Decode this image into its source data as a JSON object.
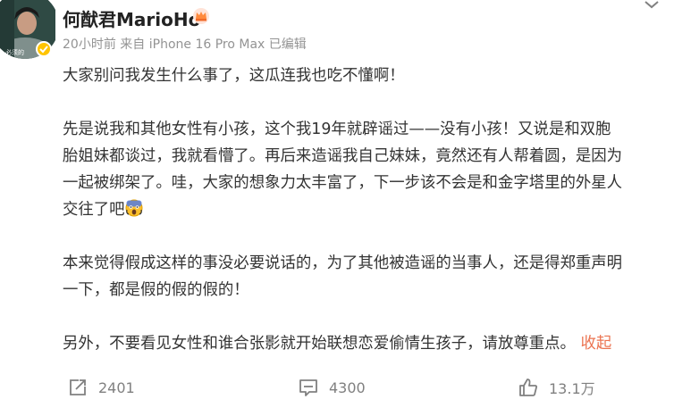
{
  "post": {
    "author": "何猷君MarioHo",
    "time": "20小时前",
    "source_prefix": "来自",
    "device": "iPhone 16 Pro Max",
    "edited": "已编辑",
    "avatar_caption": "必须的"
  },
  "content": {
    "p1": "大家别问我发生什么事了，这瓜连我也吃不懂啊！",
    "p2_l1": "先是说我和其他女性有小孩，这个我19年就辟谣过——没有小孩！又说是和双胞",
    "p2_l2": "胎姐妹都谈过，我就看懵了。再后来造谣我自己妹妹，竟然还有人帮着圆，是因为",
    "p2_l3": "一起被绑架了。哇，大家的想象力太丰富了，下一步该不会是和金字塔里的外星人",
    "p2_l4": "交往了吧",
    "p3_l1": "本来觉得假成这样的事没必要说话的，为了其他被造谣的当事人，还是得郑重声明",
    "p3_l2": "一下，都是假的假的假的！",
    "p4": "另外，不要看见女性和谁合张影就开始联想恋爱偷情生孩子，请放尊重点。",
    "collapse": "收起"
  },
  "actions": {
    "repost_count": "2401",
    "comment_count": "4300",
    "like_count": "13.1万"
  },
  "icons": {
    "verified": "verified-badge-icon",
    "crown": "crown-icon",
    "emoji": "shocked-emoji-icon",
    "repost": "repost-icon",
    "comment": "comment-icon",
    "like": "thumbs-up-icon",
    "menu": "chevron-down-icon"
  },
  "colors": {
    "accent": "#eb7350",
    "verified": "#ffc400",
    "text": "#333333",
    "meta": "#939393"
  }
}
